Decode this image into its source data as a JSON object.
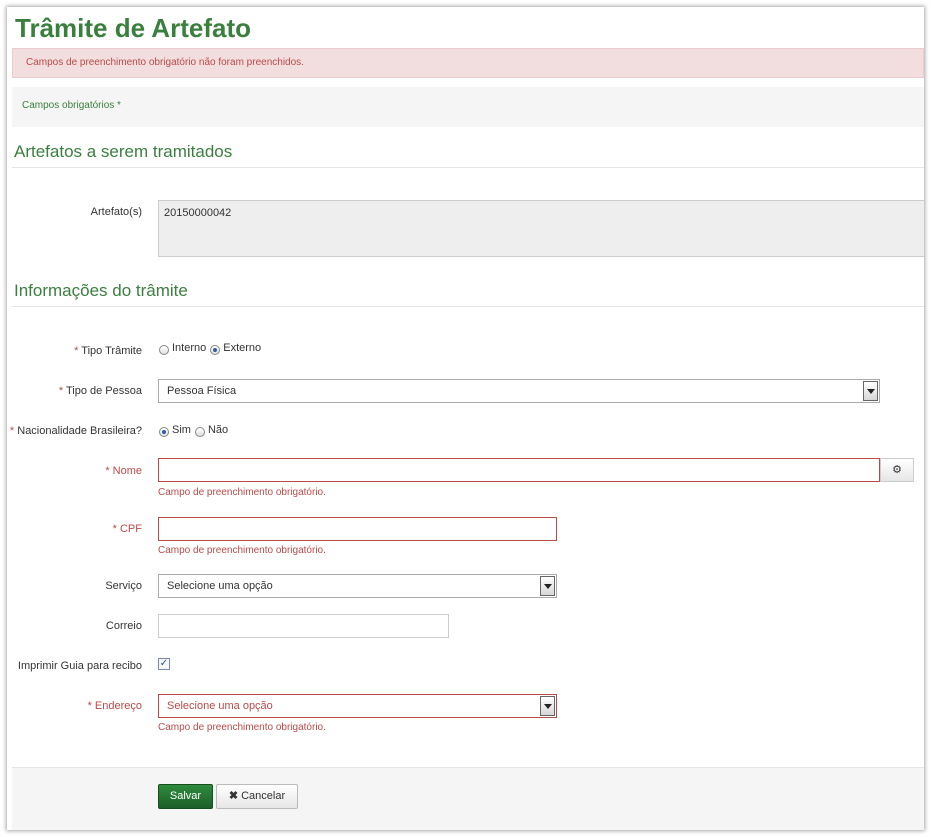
{
  "page": {
    "title": "Trâmite de Artefato",
    "alert": "Campos de preenchimento obrigatório não foram preenchidos.",
    "required_note": "Campos obrigatórios *"
  },
  "sections": {
    "artefatos": "Artefatos a serem tramitados",
    "informacoes": "Informações do trâmite"
  },
  "form": {
    "artefatos": {
      "label": "Artefato(s)",
      "value": "20150000042"
    },
    "tipo_tramite": {
      "star": "*",
      "label": "Tipo Trâmite",
      "options": [
        "Interno",
        "Externo"
      ],
      "selected": "Externo"
    },
    "tipo_pessoa": {
      "star": "*",
      "label": "Tipo de Pessoa",
      "value": "Pessoa Física"
    },
    "nacionalidade": {
      "star": "*",
      "label": "Nacionalidade Brasileira?",
      "options": [
        "Sim",
        "Não"
      ],
      "selected": "Sim"
    },
    "nome": {
      "label": "* Nome",
      "value": "",
      "error": "Campo de preenchimento obrigatório."
    },
    "cpf": {
      "label": "* CPF",
      "value": "",
      "error": "Campo de preenchimento obrigatório."
    },
    "servico": {
      "label": "Serviço",
      "value": "Selecione uma opção"
    },
    "correio": {
      "label": "Correio",
      "value": ""
    },
    "imprimir_guia": {
      "label": "Imprimir Guia para recibo",
      "checked": true
    },
    "endereco": {
      "label": "* Endereço",
      "value": "Selecione uma opção",
      "error": "Campo de preenchimento obrigatório."
    }
  },
  "actions": {
    "save": "Salvar",
    "cancel": "Cancelar"
  },
  "icons": {
    "addon": "gear-icon",
    "cancel": "close-icon",
    "checkbox": "checkmark-icon"
  },
  "colors": {
    "brand_green": "#3a7f3e",
    "error_red": "#b94a48",
    "alert_bg": "#f2dede",
    "save_button": "#1d6b2c"
  }
}
